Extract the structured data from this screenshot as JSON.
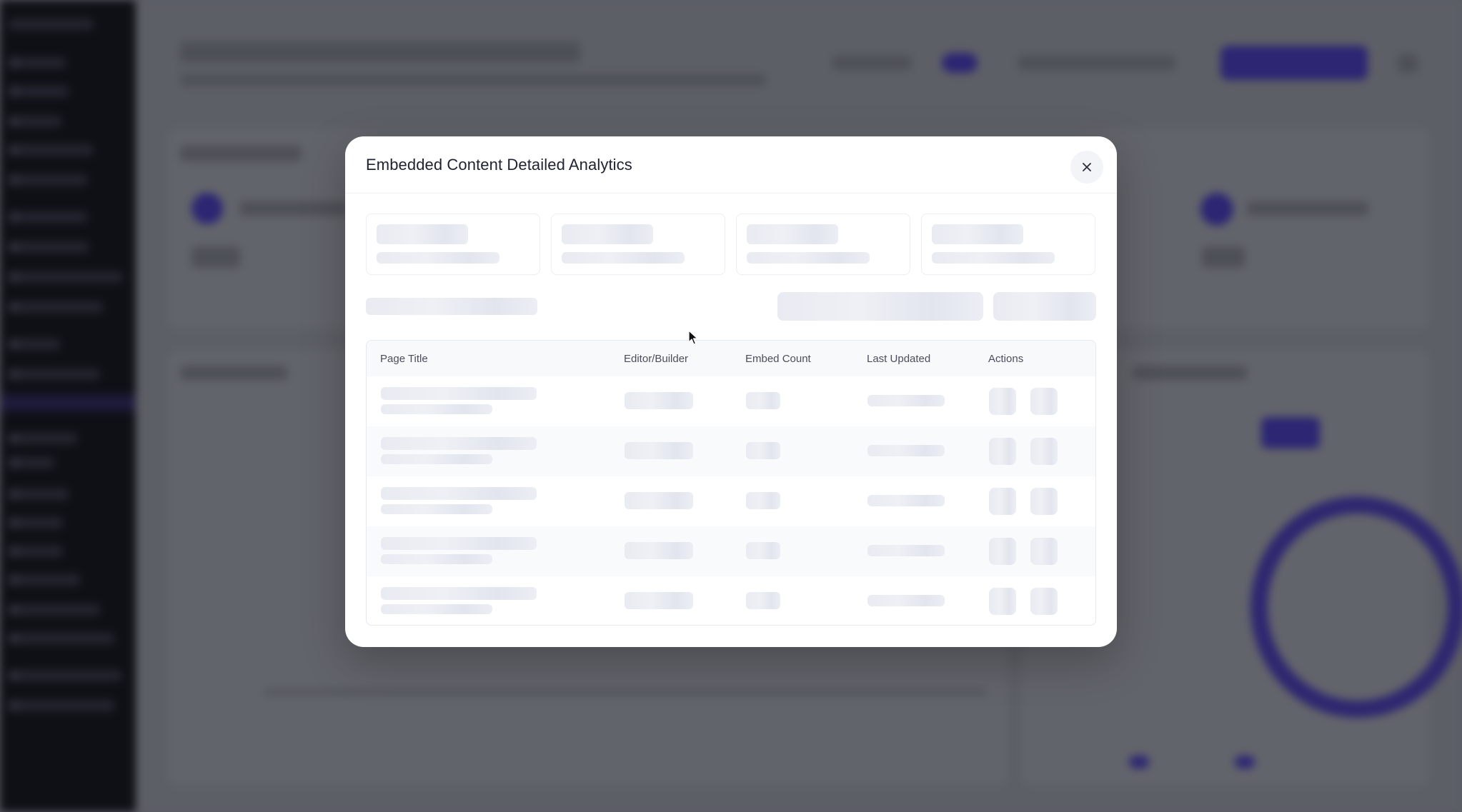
{
  "modal": {
    "title": "Embedded Content Detailed Analytics",
    "close_icon": "close-icon"
  },
  "table": {
    "columns": [
      {
        "label": "Page Title"
      },
      {
        "label": "Editor/Builder"
      },
      {
        "label": "Embed Count"
      },
      {
        "label": "Last Updated"
      },
      {
        "label": "Actions"
      }
    ],
    "row_count": 5,
    "state": "loading"
  },
  "colors": {
    "accent": "#2c2673",
    "overlay": "#5d5f66",
    "skeleton": "#e9ebf2"
  }
}
